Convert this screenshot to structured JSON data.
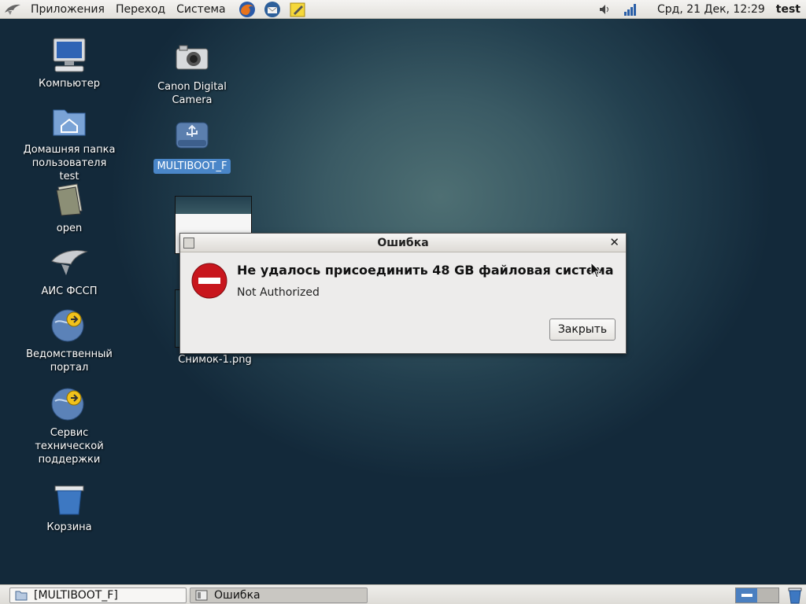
{
  "top_panel": {
    "menus": [
      "Приложения",
      "Переход",
      "Система"
    ],
    "launchers": [
      "firefox-icon",
      "thunderbird-icon",
      "notes-icon"
    ],
    "clock": "Срд, 21 Дек, 12:29",
    "user": "test"
  },
  "desktop": {
    "icons": [
      {
        "label": "Компьютер",
        "icon": "computer-icon"
      },
      {
        "label": "Домашняя папка пользователя test",
        "icon": "home-folder-icon"
      },
      {
        "label": "open",
        "icon": "open-files-icon"
      },
      {
        "label": "АИС ФССП",
        "icon": "eagle-icon"
      },
      {
        "label": "Ведомственный портал",
        "icon": "globe-link-icon"
      },
      {
        "label": "Сервис технической поддержки",
        "icon": "globe-link-icon"
      },
      {
        "label": "Корзина",
        "icon": "trash-icon"
      },
      {
        "label": "Canon Digital Camera",
        "icon": "camera-icon"
      },
      {
        "label": "MULTIBOOT_F",
        "icon": "usb-drive-icon"
      },
      {
        "label": "Снимок-1.png",
        "icon": "image-thumbnail"
      }
    ]
  },
  "dialog": {
    "title": "Ошибка",
    "heading": "Не удалось присоединить 48 GB файловая система",
    "message": "Not Authorized",
    "close_button": "Закрыть"
  },
  "bottom_panel": {
    "tasks": [
      {
        "label": "[MULTIBOOT_F]"
      },
      {
        "label": "Ошибка"
      }
    ]
  },
  "colors": {
    "error_red": "#c8161d",
    "selection_blue": "#4a86c8"
  }
}
